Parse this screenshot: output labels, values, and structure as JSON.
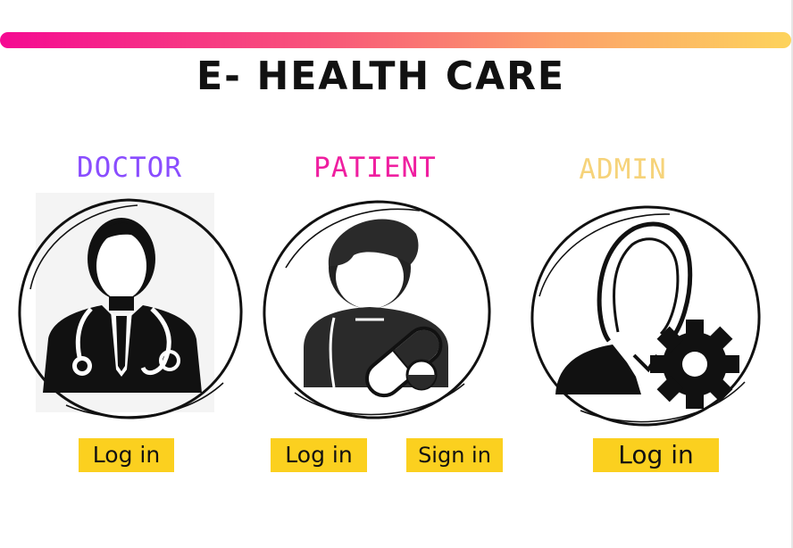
{
  "app": {
    "title": "E- HEALTH CARE"
  },
  "colors": {
    "gradient_start": "#f50a92",
    "gradient_end": "#fdd35c",
    "doctor": "#8a4dff",
    "patient": "#ef1fa0",
    "admin": "#f6d37a",
    "button": "#fbd01f"
  },
  "roles": [
    {
      "id": "doctor",
      "label": "DOCTOR",
      "icon": "doctor-icon",
      "buttons": [
        {
          "label": "Log in"
        }
      ]
    },
    {
      "id": "patient",
      "label": "PATIENT",
      "icon": "patient-icon",
      "buttons": [
        {
          "label": "Log in"
        },
        {
          "label": "Sign in"
        }
      ]
    },
    {
      "id": "admin",
      "label": "ADMIN",
      "icon": "admin-icon",
      "buttons": [
        {
          "label": "Log in"
        }
      ]
    }
  ]
}
